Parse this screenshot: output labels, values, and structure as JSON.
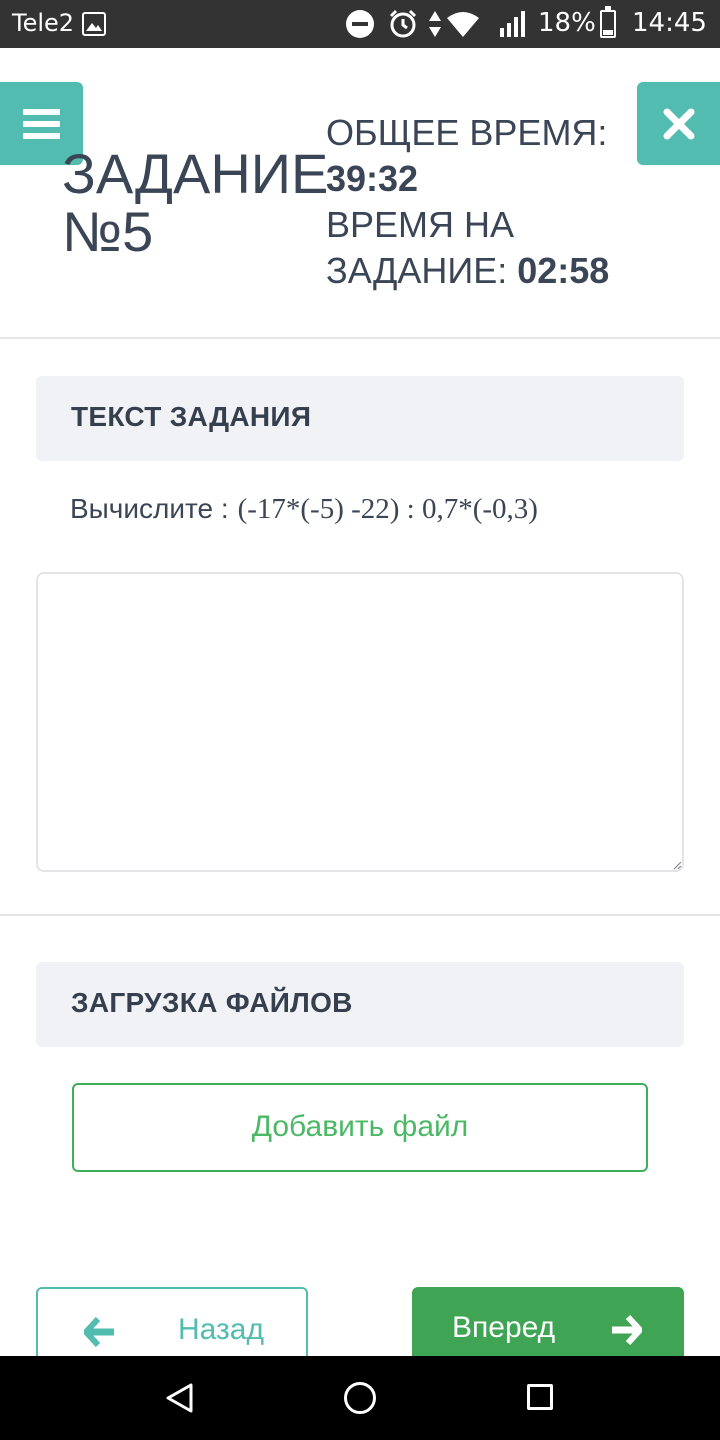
{
  "status_bar": {
    "carrier": "Tele2",
    "battery_percent": "18%",
    "time": "14:45"
  },
  "header": {
    "task_title_line1": "ЗАДАНИЕ",
    "task_title_line2": "№5",
    "total_time_label": "ОБЩЕЕ ВРЕМЯ:",
    "total_time_value": "39:32",
    "task_time_label_line1": "ВРЕМЯ НА",
    "task_time_label_line2": "ЗАДАНИЕ:",
    "task_time_value": "02:58"
  },
  "task_section": {
    "header": "ТЕКСТ ЗАДАНИЯ",
    "text_label": "Вычислите :",
    "text_expression": "(-17*(-5) -22) : 0,7*(-0,3)",
    "answer_value": ""
  },
  "upload_section": {
    "header": "ЗАГРУЗКА ФАЙЛОВ",
    "add_file_label": "Добавить файл"
  },
  "navigation": {
    "back_label": "Назад",
    "next_label": "Вперед"
  },
  "colors": {
    "teal": "#52bcb0",
    "green": "#3fa554",
    "status_bar": "#333333"
  }
}
